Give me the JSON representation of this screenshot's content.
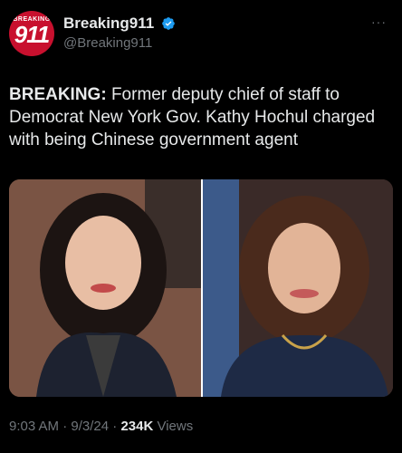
{
  "account": {
    "avatar_top_text": "BREAKING",
    "avatar_number": "911",
    "display_name": "Breaking911",
    "handle": "@Breaking911"
  },
  "post": {
    "label": "BREAKING:",
    "text": " Former deputy chief of staff to Democrat New York Gov. Kathy Hochul charged with being Chinese government agent"
  },
  "meta": {
    "time": "9:03 AM",
    "separator1": " · ",
    "date": "9/3/24",
    "separator2": " · ",
    "views_count": "234K",
    "views_label": " Views"
  },
  "colors": {
    "background": "#000000",
    "text": "#e7e9ea",
    "secondary": "#71767b",
    "verified": "#1d9bf0",
    "avatar": "#c8102e"
  }
}
